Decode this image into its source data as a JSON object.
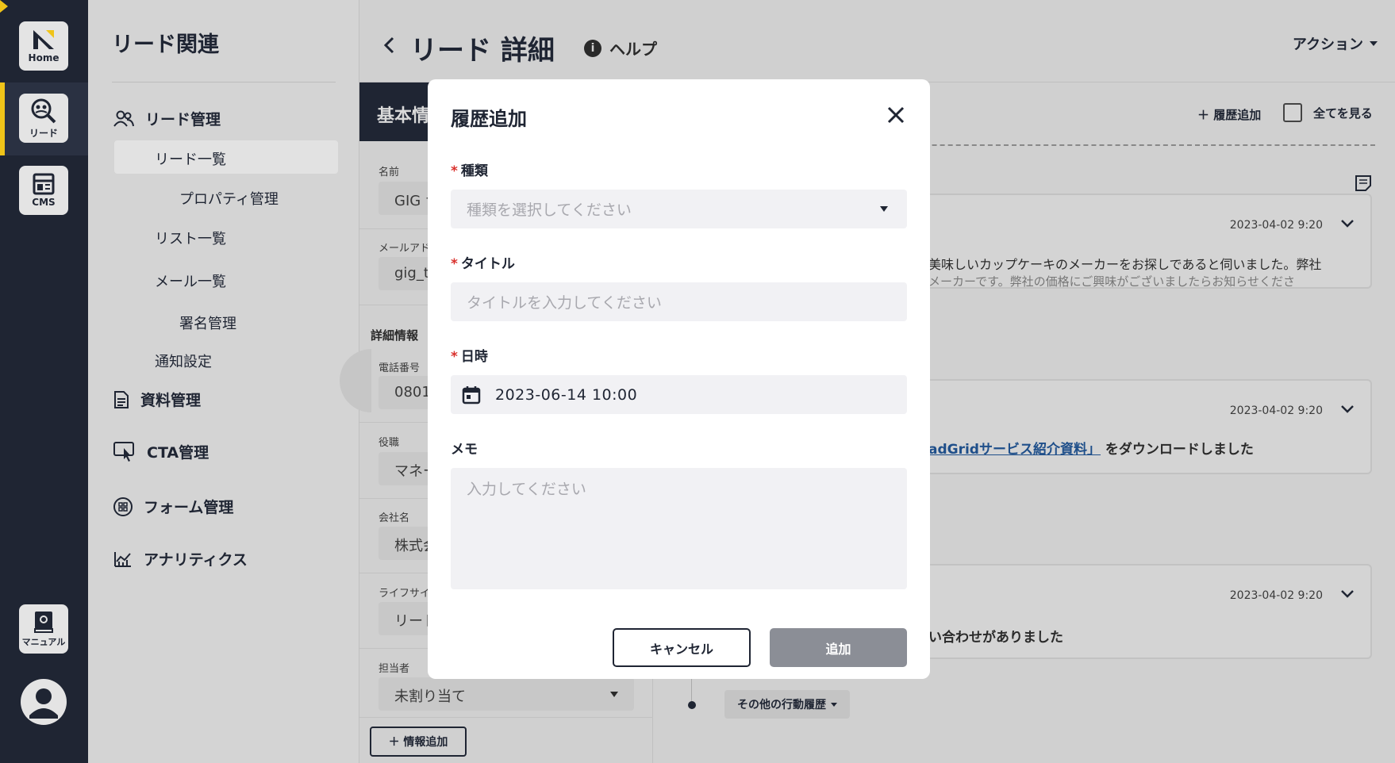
{
  "rail": {
    "home_label": "Home",
    "lead_label": "リード",
    "cms_label": "CMS",
    "manual_label": "マニュアル"
  },
  "subnav": {
    "title": "リード関連",
    "lead_mgmt": "リード管理",
    "lead_list": "リード一覧",
    "property_mgmt": "プロパティ管理",
    "list_list": "リスト一覧",
    "mail_list": "メール一覧",
    "signature_mgmt": "署名管理",
    "notify_settings": "通知設定",
    "docs_mgmt": "資料管理",
    "cta_mgmt": "CTA管理",
    "form_mgmt": "フォーム管理",
    "analytics": "アナリティクス"
  },
  "header": {
    "title": "リード 詳細",
    "help": "ヘルプ",
    "action": "アクション"
  },
  "info": {
    "tab_label": "基本情",
    "name_label": "名前",
    "name_value": "GIG ナ",
    "email_label": "メールアド",
    "email_value": "gig_t",
    "detail_label": "詳細情報",
    "phone_label": "電話番号",
    "phone_value": "0801",
    "role_label": "役職",
    "role_value": "マネー",
    "company_label": "会社名",
    "company_value": "株式会",
    "lifecycle_label": "ライフサイ",
    "lifecycle_value": "リード",
    "owner_label": "担当者",
    "owner_value": "未割り当て",
    "add_info": "＋ 情報追加"
  },
  "timeline": {
    "add_history": "＋ 履歴追加",
    "show_all": "全てを見る",
    "cards": [
      {
        "date": "2023-04-02 9:20",
        "text1": "美味しいカップケーキのメーカーをお探しであると伺いました。弊社",
        "text2": "メーカーです。弊社の価格にご興味がございましたらお知らせくださ"
      },
      {
        "date": "2023-04-02 9:20",
        "link": "adGridサービス紹介資料」",
        "text": "をダウンロードしました"
      },
      {
        "date": "2023-04-02 9:20",
        "text": "い合わせがありました"
      }
    ],
    "other_history": "その他の行動履歴"
  },
  "modal": {
    "title": "履歴追加",
    "type_label": "種類",
    "type_placeholder": "種類を選択してください",
    "title_label": "タイトル",
    "title_placeholder": "タイトルを入力してください",
    "datetime_label": "日時",
    "datetime_value": "2023-06-14 10:00",
    "memo_label": "メモ",
    "memo_placeholder": "入力してください",
    "cancel": "キャンセル",
    "add": "追加",
    "required_mark": "*"
  }
}
